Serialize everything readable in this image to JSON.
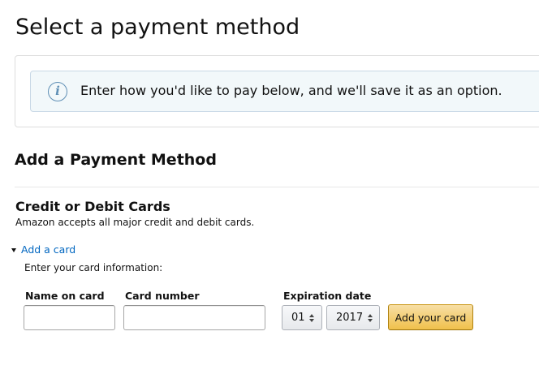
{
  "page": {
    "title": "Select a payment method"
  },
  "info": {
    "icon": "info-icon",
    "icon_glyph": "i",
    "message": "Enter how you'd like to pay below, and we'll save it as an option.",
    "accent_color": "#5f8fb5",
    "background_color": "#f2f8fa"
  },
  "add_payment": {
    "title": "Add a Payment Method",
    "cards_heading": "Credit or Debit Cards",
    "cards_subtitle": "Amazon accepts all major credit and debit cards.",
    "add_card_link": "Add a card",
    "enter_info": "Enter your card information:",
    "link_color": "#0066c0"
  },
  "form": {
    "name_label": "Name on card",
    "name_value": "",
    "number_label": "Card number",
    "number_value": "",
    "expiration_label": "Expiration date",
    "month_value": "01",
    "year_value": "2017",
    "submit_label": "Add your card",
    "submit_color": "#f0c14b"
  }
}
